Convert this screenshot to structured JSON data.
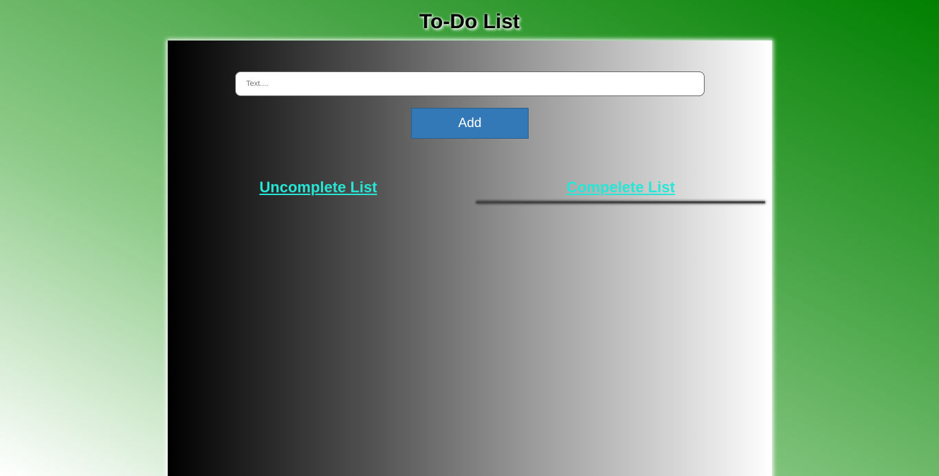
{
  "header": {
    "title": "To-Do List"
  },
  "form": {
    "input_placeholder": "Text....",
    "input_value": "",
    "add_label": "Add"
  },
  "lists": {
    "uncomplete_title": "Uncomplete List",
    "complete_title": "Compelete List"
  },
  "colors": {
    "accent_heading": "#26e6d6",
    "button": "#3379b7",
    "background_green": "#008000"
  }
}
